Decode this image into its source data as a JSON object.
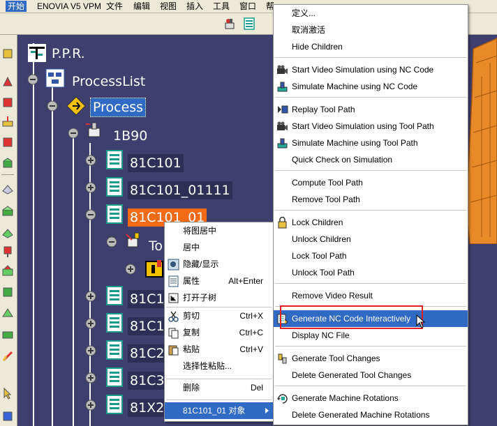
{
  "menubar": {
    "items": [
      "开始",
      "ENOVIA V5 VPM",
      "文件",
      "编辑",
      "视图",
      "插入",
      "工具",
      "窗口",
      "帮"
    ]
  },
  "tree": {
    "root": "P.P.R.",
    "process_list": "ProcessList",
    "process": "Process",
    "program": "1B90",
    "ops": [
      "81C101",
      "81C101_01111",
      "81C101_01",
      "81C1",
      "81C1",
      "81C2",
      "81C3",
      "81X2"
    ],
    "tool": "To"
  },
  "context_menu": {
    "items": [
      {
        "label": "将图居中"
      },
      {
        "label": "居中"
      },
      {
        "label": "隐藏/显示",
        "icon": "hide-show-icon"
      },
      {
        "label": "属性",
        "shortcut": "Alt+Enter",
        "icon": "properties-icon"
      },
      {
        "label": "打开子树",
        "icon": "open-subtree-icon"
      },
      {
        "label": "剪切",
        "shortcut": "Ctrl+X",
        "icon": "scissors-icon"
      },
      {
        "label": "复制",
        "shortcut": "Ctrl+C",
        "icon": "copy-icon"
      },
      {
        "label": "粘贴",
        "shortcut": "Ctrl+V",
        "icon": "paste-icon"
      },
      {
        "label": "选择性粘贴..."
      },
      {
        "label": "删除",
        "shortcut": "Del"
      },
      {
        "label": "81C101_01 对象"
      }
    ]
  },
  "sub_menu": {
    "items": [
      "定义...",
      "取消激活",
      "Hide Children",
      "Start Video Simulation using NC Code",
      "Simulate Machine using NC Code",
      "Replay Tool Path",
      "Start Video Simulation using Tool Path",
      "Simulate Machine using Tool Path",
      "Quick Check on Simulation",
      "Compute Tool Path",
      "Remove Tool Path",
      "Lock Children",
      "Unlock Children",
      "Lock Tool Path",
      "Unlock Tool Path",
      "Remove Video Result",
      "Generate NC Code Interactively",
      "Display NC File",
      "Generate Tool Changes",
      "Delete Generated Tool Changes",
      "Generate Machine Rotations",
      "Delete Generated Machine Rotations"
    ]
  },
  "colors": {
    "highlight": "#316ac5",
    "selected_node": "#f06a18",
    "background": "#3e3f6e",
    "callout": "#e02020"
  }
}
